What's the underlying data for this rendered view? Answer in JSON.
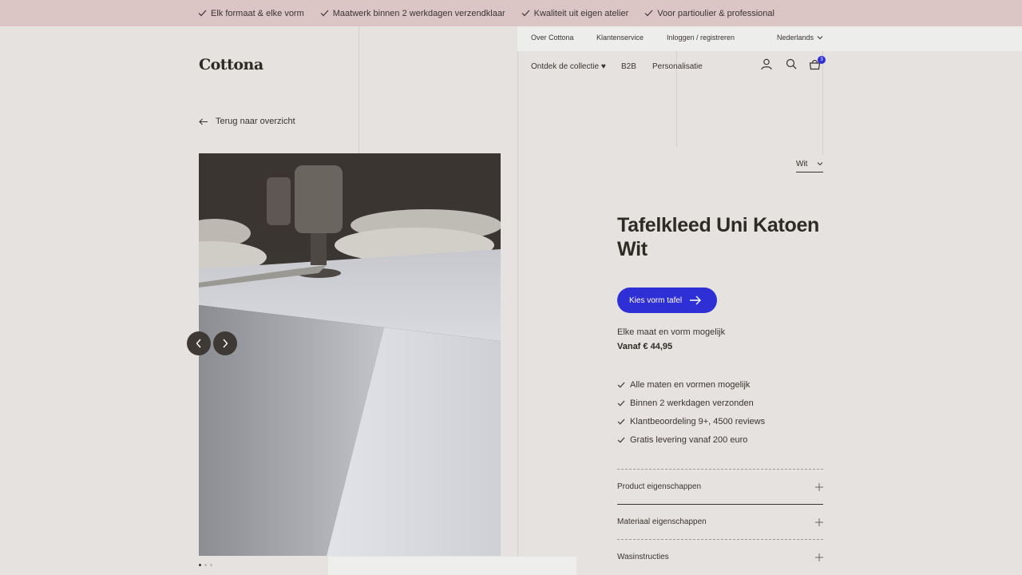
{
  "usp_bar": {
    "items": [
      "Elk formaat & elke vorm",
      "Maatwerk binnen 2 werkdagen verzendklaar",
      "Kwaliteit uit eigen atelier",
      "Voor partioulier & professional"
    ]
  },
  "util_nav": {
    "about": "Over Cottona",
    "service": "Klantenservice",
    "login": "Inloggen / registreren",
    "language": "Nederlands"
  },
  "logo": "Cottona",
  "main_nav": {
    "collection": "Ontdek de collectie ♥",
    "b2b": "B2B",
    "personalize": "Personalisatie"
  },
  "cart_count": "3",
  "back_link": "Terug naar overzicht",
  "color_select": {
    "value": "Wit"
  },
  "product": {
    "title": "Tafelkleed Uni Katoen Wit",
    "cta": "Kies vorm tafel",
    "subline": "Elke maat en vorm mogelijk",
    "price": "Vanaf € 44,95"
  },
  "features": [
    "Alle maten en vormen mogelijk",
    "Binnen 2 werkdagen verzonden",
    "Klantbeoordeling 9+, 4500 reviews",
    "Gratis levering vanaf 200 euro"
  ],
  "accordion": [
    "Product eigenschappen",
    "Materiaal eigenschappen",
    "Wasinstructies"
  ],
  "colors": {
    "accent": "#2f2fd6",
    "usp_bg": "#dcc5c5",
    "page_bg": "#e5e2df"
  }
}
